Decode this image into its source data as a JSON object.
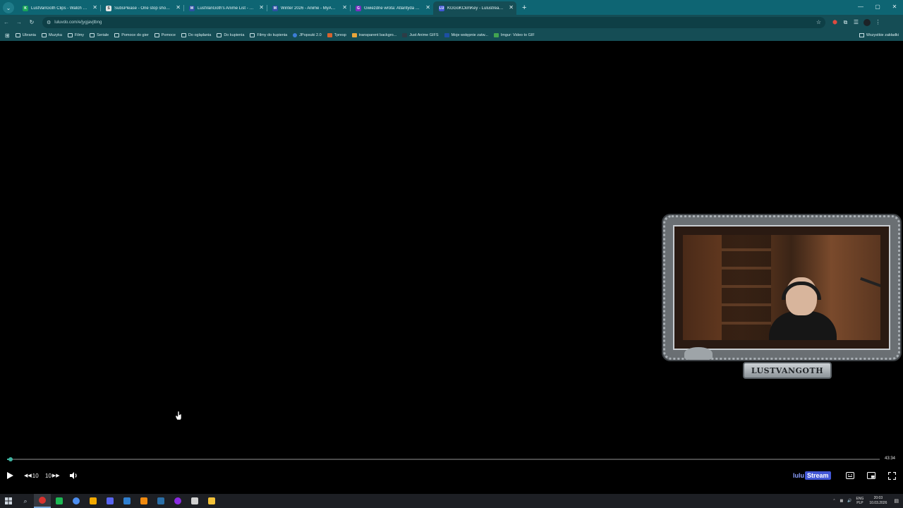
{
  "browser": {
    "tabs": [
      {
        "title": "LustVanGoth Clips - Watch Liv",
        "favicon_color": "#1aa35a",
        "favicon_letter": "K",
        "active": false
      },
      {
        "title": "SubsPlease - One stop shop fo",
        "favicon_color": "#e6e6e6",
        "favicon_letter": "S",
        "active": false
      },
      {
        "title": "LustVanGoth's Anime List - My",
        "favicon_color": "#2e51a2",
        "favicon_letter": "M",
        "active": false
      },
      {
        "title": "Winter 2026 - Anime - MyAnim",
        "favicon_color": "#2e51a2",
        "favicon_letter": "M",
        "active": false
      },
      {
        "title": "Gwiezdne wrota: Atlantyda / St",
        "favicon_color": "#7b2fbf",
        "favicon_letter": "G",
        "active": false
      },
      {
        "title": "KGGoKCkmKey - Lulustream.m",
        "favicon_color": "#4257d6",
        "favicon_letter": "LU",
        "active": true
      }
    ],
    "new_tab_icon": "plus-icon",
    "url": "luluvdo.com/e/jygjavjtbng",
    "bookmarks": [
      {
        "label": "Ubrania",
        "type": "folder"
      },
      {
        "label": "Muzyka",
        "type": "folder"
      },
      {
        "label": "Filmy",
        "type": "folder"
      },
      {
        "label": "Seriale",
        "type": "folder"
      },
      {
        "label": "Pomoce do gier",
        "type": "folder"
      },
      {
        "label": "Pomoce",
        "type": "folder"
      },
      {
        "label": "Do oglądania",
        "type": "folder"
      },
      {
        "label": "Do kupienia",
        "type": "folder"
      },
      {
        "label": "Filmy do kupienia",
        "type": "folder"
      },
      {
        "label": "JPopsuki 2.0",
        "type": "dot"
      },
      {
        "label": "Tpresp",
        "type": "red"
      },
      {
        "label": "transparent backgro...",
        "type": "orange"
      },
      {
        "label": "Just Anime GIFS",
        "type": "dark"
      },
      {
        "label": "Moje wstępnie zatw...",
        "type": "blue"
      },
      {
        "label": "Imgur: Video to GIF",
        "type": "green"
      }
    ],
    "bookmarks_right": "Wszystkie zakładki"
  },
  "player": {
    "webcam_name": "LUSTVANGOTH",
    "duration": "43:34",
    "progress": 0.004,
    "rewind_label": "10",
    "forward_label": "10",
    "brand_part1": "lulu",
    "brand_part2": "Stream"
  },
  "taskbar": {
    "apps": [
      {
        "name": "opera-gx-icon",
        "color": "#d8322e",
        "active": true
      },
      {
        "name": "spotify-icon",
        "color": "#1db954",
        "active": false
      },
      {
        "name": "chrome-icon",
        "color": "#4c8ef0",
        "active": false
      },
      {
        "name": "app-a-icon",
        "color": "#f2a900",
        "active": false
      },
      {
        "name": "discord-icon",
        "color": "#5865f2",
        "active": false
      },
      {
        "name": "notepad-icon",
        "color": "#2f7fd0",
        "active": false
      },
      {
        "name": "vlc-icon",
        "color": "#f08a10",
        "active": false
      },
      {
        "name": "steam-icon",
        "color": "#2a6fa8",
        "active": false
      },
      {
        "name": "obs-icon",
        "color": "#8a2be2",
        "active": false
      },
      {
        "name": "app-b-icon",
        "color": "#d0d0d0",
        "active": false
      },
      {
        "name": "file-explorer-icon",
        "color": "#f3c238",
        "active": false
      }
    ],
    "lang_top": "ENG",
    "lang_bottom": "PLP",
    "time": "20:03",
    "date": "10.03.2026"
  }
}
